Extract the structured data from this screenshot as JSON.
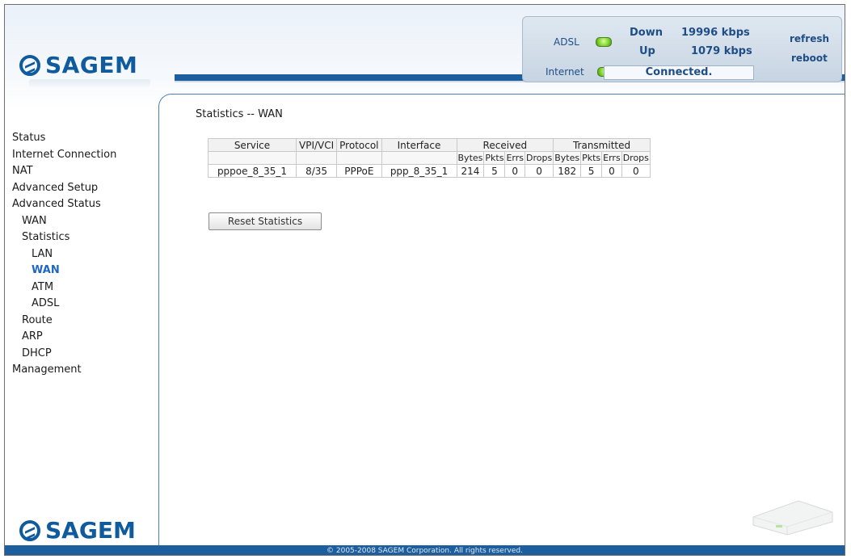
{
  "brand": {
    "name": "SAGEM",
    "color": "#0f5b9e"
  },
  "status": {
    "adsl_label": "ADSL",
    "internet_label": "Internet",
    "down_label": "Down",
    "up_label": "Up",
    "down_rate": "19996 kbps",
    "up_rate": "1079 kbps",
    "connection_status": "Connected.",
    "refresh_label": "refresh",
    "reboot_label": "reboot"
  },
  "sidebar": {
    "items": [
      {
        "label": "Status",
        "level": 1
      },
      {
        "label": "Internet Connection",
        "level": 1
      },
      {
        "label": "NAT",
        "level": 1
      },
      {
        "label": "Advanced Setup",
        "level": 1
      },
      {
        "label": "Advanced Status",
        "level": 1
      },
      {
        "label": "WAN",
        "level": 2
      },
      {
        "label": "Statistics",
        "level": 2
      },
      {
        "label": "LAN",
        "level": 3
      },
      {
        "label": "WAN",
        "level": 3,
        "active": true
      },
      {
        "label": "ATM",
        "level": 3
      },
      {
        "label": "ADSL",
        "level": 3
      },
      {
        "label": "Route",
        "level": 2
      },
      {
        "label": "ARP",
        "level": 2
      },
      {
        "label": "DHCP",
        "level": 2
      },
      {
        "label": "Management",
        "level": 1
      }
    ]
  },
  "page": {
    "title": "Statistics -- WAN"
  },
  "table": {
    "headers": {
      "service": "Service",
      "vpi_vci": "VPI/VCI",
      "protocol": "Protocol",
      "interface": "Interface",
      "received": "Received",
      "transmitted": "Transmitted"
    },
    "subheaders": [
      "Bytes",
      "Pkts",
      "Errs",
      "Drops",
      "Bytes",
      "Pkts",
      "Errs",
      "Drops"
    ],
    "rows": [
      [
        "pppoe_8_35_1",
        "8/35",
        "PPPoE",
        "ppp_8_35_1",
        "214",
        "5",
        "0",
        "0",
        "182",
        "5",
        "0",
        "0"
      ]
    ]
  },
  "buttons": {
    "reset_label": "Reset Statistics"
  },
  "footer": {
    "copyright": "© 2005-2008 SAGEM Corporation. All rights reserved."
  }
}
